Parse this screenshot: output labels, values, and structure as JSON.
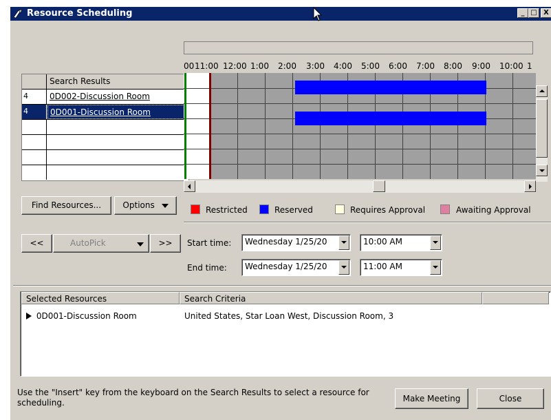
{
  "window": {
    "title": "Resource Scheduling",
    "min": "_",
    "max": "□",
    "close": "X"
  },
  "search": {
    "header": "Search Results",
    "rows": [
      {
        "num": "4",
        "name": "0D002-Discussion Room"
      },
      {
        "num": "4",
        "name": "0D001-Discussion Room"
      }
    ]
  },
  "timeline": {
    "hours": [
      "00",
      "11:00",
      "12:00",
      "1:00",
      "2:00",
      "3:00",
      "4:00",
      "5:00",
      "6:00",
      "7:00",
      "8:00",
      "9:00",
      "10:00",
      "1"
    ]
  },
  "buttons": {
    "find": "Find Resources...",
    "options": "Options",
    "prev": "<<",
    "autopick": "AutoPick",
    "next": ">>",
    "make_meeting": "Make Meeting",
    "close": "Close"
  },
  "legend": [
    {
      "label": "Restricted",
      "color": "#ff0000"
    },
    {
      "label": "Reserved",
      "color": "#0000ff"
    },
    {
      "label": "Requires Approval",
      "color": "#ffffe0"
    },
    {
      "label": "Awaiting Approval",
      "color": "#e080a0"
    }
  ],
  "times": {
    "start_label": "Start time:",
    "start_date": "Wednesday 1/25/20",
    "start_time": "10:00 AM",
    "end_label": "End time:",
    "end_date": "Wednesday 1/25/20",
    "end_time": "11:00 AM"
  },
  "selected": {
    "col1": "Selected Resources",
    "col2": "Search Criteria",
    "row_name": "0D001-Discussion Room",
    "row_criteria": "United States, Star Loan West, Discussion Room, 3"
  },
  "hint": "Use the \"Insert\" key from the keyboard on the Search Results to select a resource for scheduling.",
  "colors": {
    "title_bar": "#0a246a",
    "reserved": "#0000ff",
    "busy": "#a0a0a0",
    "selection": "#0a246a"
  }
}
